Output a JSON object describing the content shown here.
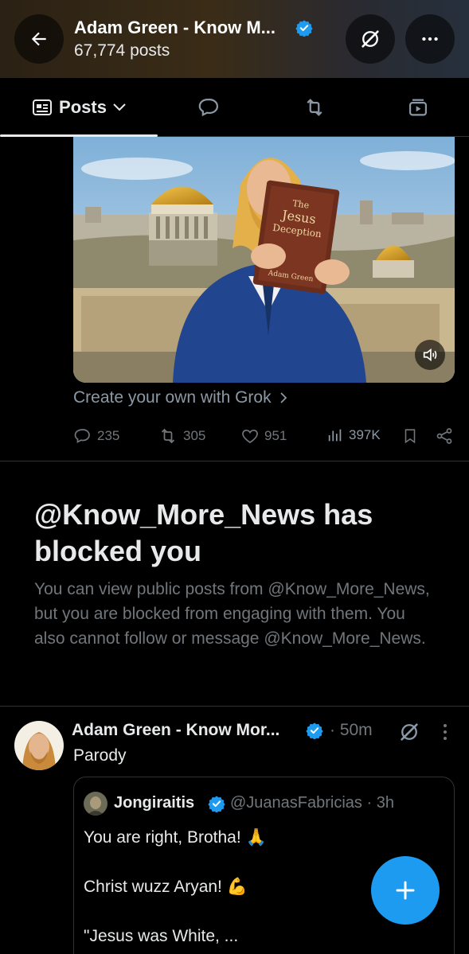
{
  "header": {
    "title": "Adam Green - Know M...",
    "post_count": "67,774 posts"
  },
  "tabs": {
    "posts_label": "Posts",
    "items": [
      "posts",
      "replies",
      "reposts",
      "media"
    ]
  },
  "media": {
    "book_line1": "The",
    "book_line2": "Jesus",
    "book_line3": "Deception",
    "book_author": "Adam Green"
  },
  "grok_link": "Create your own with Grok",
  "actions": {
    "replies": "235",
    "reposts": "305",
    "likes": "951",
    "views": "397K"
  },
  "blocked": {
    "title": "@Know_More_News has blocked you",
    "body": "You can view public posts from @Know_More_News, but you are blocked from engaging with them. You also cannot follow or message @Know_More_News."
  },
  "post": {
    "author": "Adam Green - Know Mor...",
    "time": "· 50m",
    "label": "Parody"
  },
  "quote": {
    "name": "Jongiraitis",
    "handle": "@JuanasFabricias · 3h",
    "line1": "You are right, Brotha! 🙏",
    "line2": "Christ wuzz Aryan! 💪",
    "line3": "\"Jesus was White, ..."
  },
  "colors": {
    "accent": "#1d9bf0",
    "verified": "#1d9bf0",
    "muted": "#71767b",
    "text": "#e7e9ea",
    "border": "#2f3336"
  }
}
